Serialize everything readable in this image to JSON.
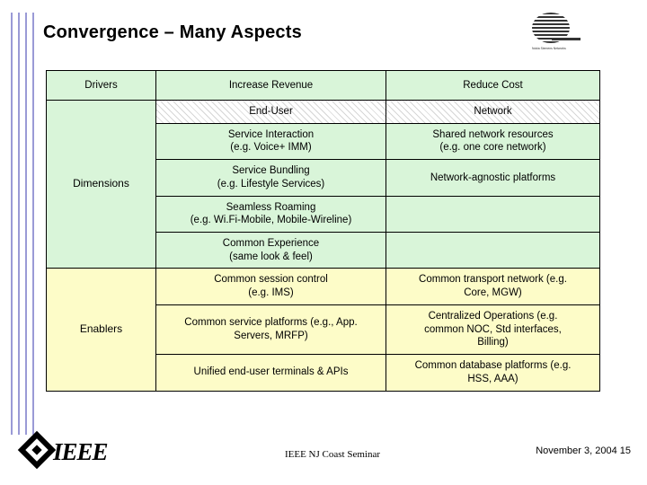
{
  "slide": {
    "title": "Convergence – Many Aspects",
    "logo_caption": "Nokia Siemens Networks",
    "table": {
      "headers": [
        "Drivers",
        "Increase Revenue",
        "Reduce Cost"
      ],
      "row_labels": {
        "dimensions": "Dimensions",
        "enablers": "Enablers"
      },
      "rows": [
        {
          "style": "hatch",
          "cells": [
            {
              "lines": [
                "End-User"
              ]
            },
            {
              "lines": [
                "Network"
              ]
            }
          ]
        },
        {
          "style": "green",
          "cells": [
            {
              "lines": [
                "Service Interaction",
                "(e.g. Voice+ IMM)"
              ]
            },
            {
              "lines": [
                "Shared network resources",
                "(e.g. one core network)"
              ]
            }
          ]
        },
        {
          "style": "green",
          "cells": [
            {
              "lines": [
                "Service Bundling",
                "(e.g. Lifestyle Services)"
              ]
            },
            {
              "lines": [
                "Network-agnostic platforms"
              ]
            }
          ]
        },
        {
          "style": "green",
          "cells": [
            {
              "lines": [
                "Seamless Roaming",
                "(e.g. Wi.Fi-Mobile, Mobile-Wireline)"
              ]
            },
            {
              "lines": [
                ""
              ]
            }
          ]
        },
        {
          "style": "green",
          "cells": [
            {
              "lines": [
                "Common Experience",
                "(same look & feel)"
              ]
            },
            {
              "lines": [
                ""
              ]
            }
          ]
        },
        {
          "style": "yellow",
          "cells": [
            {
              "lines": [
                "Common session control",
                "(e.g. IMS)"
              ]
            },
            {
              "lines": [
                "Common transport network (e.g.",
                "Core, MGW)"
              ]
            }
          ]
        },
        {
          "style": "yellow",
          "cells": [
            {
              "lines": [
                "Common service platforms (e.g., App.",
                "Servers, MRFP)"
              ]
            },
            {
              "lines": [
                "Centralized Operations (e.g.",
                "common NOC, Std interfaces,",
                "Billing)"
              ]
            }
          ]
        },
        {
          "style": "yellow",
          "cells": [
            {
              "lines": [
                "Unified end-user terminals & APIs"
              ]
            },
            {
              "lines": [
                "Common database platforms (e.g.",
                "HSS, AAA)"
              ]
            }
          ]
        }
      ]
    },
    "footer": {
      "logo_text": "IEEE",
      "center": "IEEE NJ Coast Seminar",
      "right": "November 3, 2004 15"
    }
  }
}
